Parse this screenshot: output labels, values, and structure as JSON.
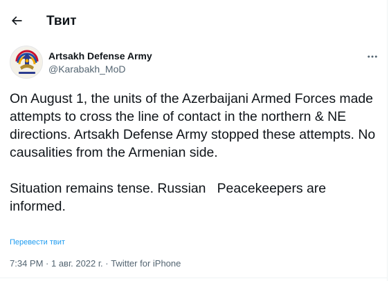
{
  "header": {
    "title": "Твит"
  },
  "author": {
    "display_name": "Artsakh Defense Army",
    "handle": "@Karabakh_MoD"
  },
  "tweet": {
    "text": "On August 1, the units of the Azerbaijani Armed Forces made attempts to cross the line of contact in the northern & NE directions. Artsakh Defense Army stopped these attempts. No causalities from the Armenian side.\n\nSituation remains tense. Russian   Peacekeepers are informed.",
    "translate_label": "Перевести твит"
  },
  "meta": {
    "time": "7:34 PM",
    "separator": " · ",
    "date": "1 авг. 2022 г.",
    "source": "Twitter for iPhone"
  },
  "colors": {
    "text_primary": "#0f1419",
    "text_secondary": "#536471",
    "link": "#1d9bf0"
  },
  "icons": {
    "back": "arrow-left-icon",
    "more": "more-horizontal-icon",
    "avatar": "artsakh-defense-army-emblem"
  }
}
